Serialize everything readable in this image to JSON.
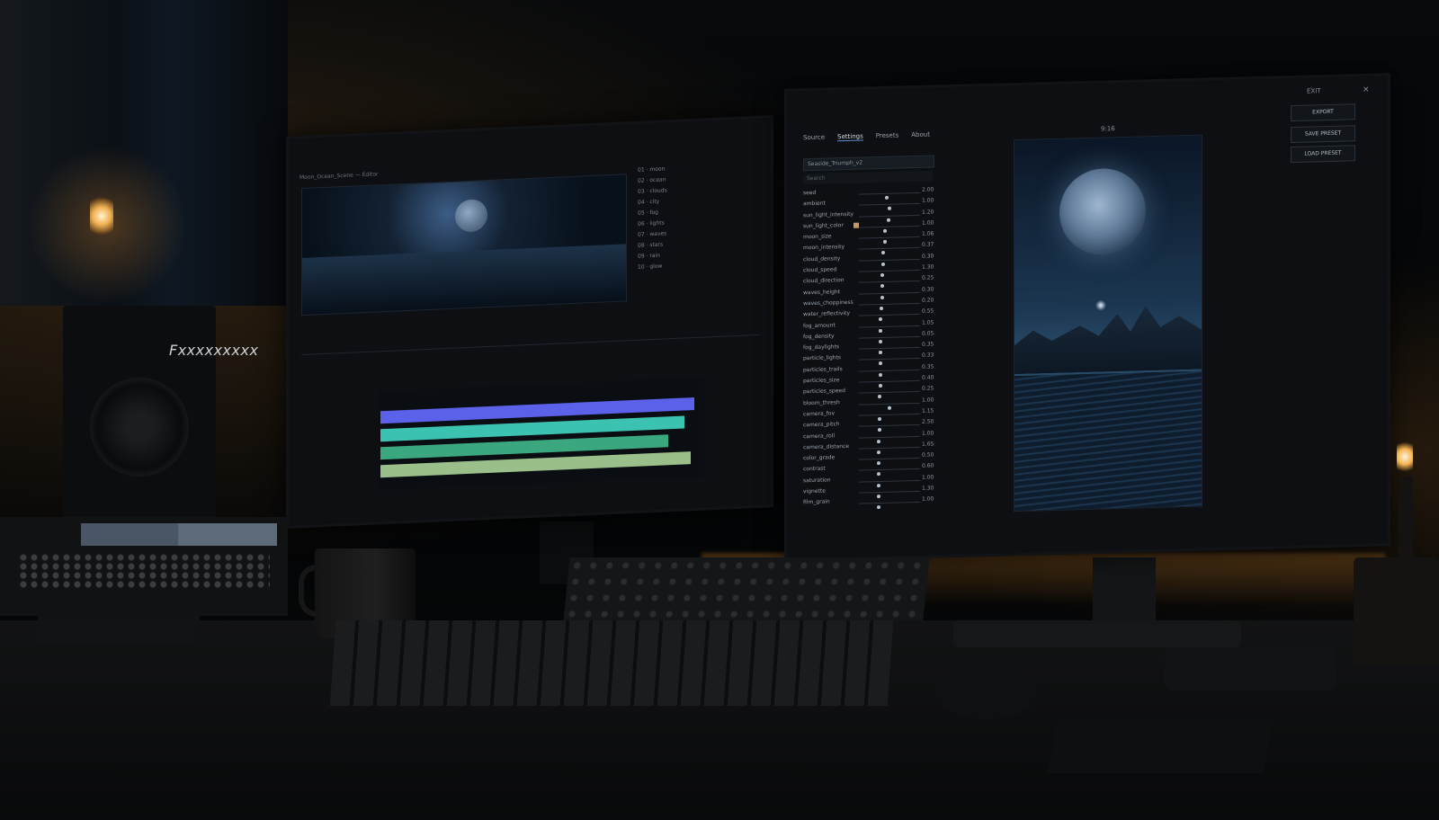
{
  "speaker": {
    "logo": "Fxxxxxxxxx"
  },
  "left_monitor": {
    "title": "Moon_Ocean_Scene — Editor",
    "list_items": [
      "01 · moon",
      "02 · ocean",
      "03 · clouds",
      "04 · city",
      "05 · fog",
      "06 · lights",
      "07 · waves",
      "08 · stars",
      "09 · rain",
      "10 · glow"
    ],
    "tracks": [
      {
        "color": "#5b61e8",
        "fill": 0.98
      },
      {
        "color": "#3cc2b0",
        "fill": 0.95
      },
      {
        "color": "#3aa77e",
        "fill": 0.9
      },
      {
        "color": "#9bbf8a",
        "fill": 0.97
      }
    ]
  },
  "right_monitor": {
    "tabs": [
      "Source",
      "Settings",
      "Presets",
      "About"
    ],
    "active_tab": "Settings",
    "aspect_ratio": "9:16",
    "exit_label": "EXIT",
    "buttons": {
      "export": "EXPORT",
      "save_preset": "SAVE PRESET",
      "load_preset": "LOAD PRESET"
    },
    "preset_name": "Seaside_Triumph_v2",
    "search_placeholder": "Search",
    "params": [
      {
        "name": "seed",
        "value": "2.00",
        "level": 0.45
      },
      {
        "name": "ambient",
        "value": "1.00",
        "level": 0.5
      },
      {
        "name": "sun_light_intensity",
        "value": "1.20",
        "level": 0.48
      },
      {
        "name": "sun_light_color",
        "value": "1.00",
        "level": 0.42,
        "swatch": "#c39a68"
      },
      {
        "name": "moon_size",
        "value": "1.06",
        "level": 0.42
      },
      {
        "name": "moon_intensity",
        "value": "0.37",
        "level": 0.4
      },
      {
        "name": "cloud_density",
        "value": "0.30",
        "level": 0.4
      },
      {
        "name": "cloud_speed",
        "value": "1.30",
        "level": 0.38
      },
      {
        "name": "cloud_direction",
        "value": "0.25",
        "level": 0.38
      },
      {
        "name": "waves_height",
        "value": "0.30",
        "level": 0.38
      },
      {
        "name": "waves_choppiness",
        "value": "0.20",
        "level": 0.37
      },
      {
        "name": "water_reflectivity",
        "value": "0.55",
        "level": 0.36
      },
      {
        "name": "fog_amount",
        "value": "1.05",
        "level": 0.36
      },
      {
        "name": "fog_density",
        "value": "0.05",
        "level": 0.36
      },
      {
        "name": "fog_daylights",
        "value": "0.35",
        "level": 0.35
      },
      {
        "name": "particle_lights",
        "value": "0.33",
        "level": 0.35
      },
      {
        "name": "particles_trails",
        "value": "0.35",
        "level": 0.35
      },
      {
        "name": "particles_size",
        "value": "0.40",
        "level": 0.35
      },
      {
        "name": "particles_speed",
        "value": "0.25",
        "level": 0.34
      },
      {
        "name": "bloom_thresh",
        "value": "1.00",
        "level": 0.5
      },
      {
        "name": "camera_fov",
        "value": "1.15",
        "level": 0.34
      },
      {
        "name": "camera_pitch",
        "value": "2.50",
        "level": 0.34
      },
      {
        "name": "camera_roll",
        "value": "1.00",
        "level": 0.33
      },
      {
        "name": "camera_distance",
        "value": "1.65",
        "level": 0.33
      },
      {
        "name": "color_grade",
        "value": "0.50",
        "level": 0.33
      },
      {
        "name": "contrast",
        "value": "0.60",
        "level": 0.33
      },
      {
        "name": "saturation",
        "value": "1.00",
        "level": 0.33
      },
      {
        "name": "vignette",
        "value": "1.30",
        "level": 0.33
      },
      {
        "name": "film_grain",
        "value": "1.00",
        "level": 0.33
      }
    ]
  }
}
